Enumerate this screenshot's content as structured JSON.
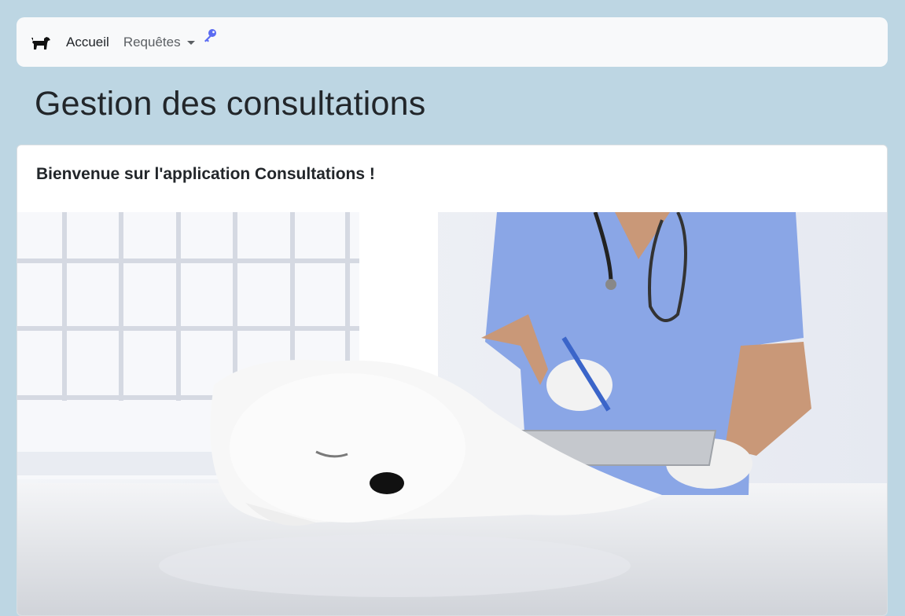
{
  "navbar": {
    "brand_icon": "dog-icon",
    "home_label": "Accueil",
    "requests_label": "Requêtes",
    "key_icon": "key-icon",
    "key_color": "#5a6bf2"
  },
  "page": {
    "title": "Gestion des consultations"
  },
  "card": {
    "title": "Bienvenue sur l'application Consultations !",
    "image_subject": "veterinarian-with-white-dog-image"
  },
  "colors": {
    "background": "#bdd6e3",
    "navbar_bg": "#f8f9fa",
    "scrubs": "#8aa6e6"
  }
}
